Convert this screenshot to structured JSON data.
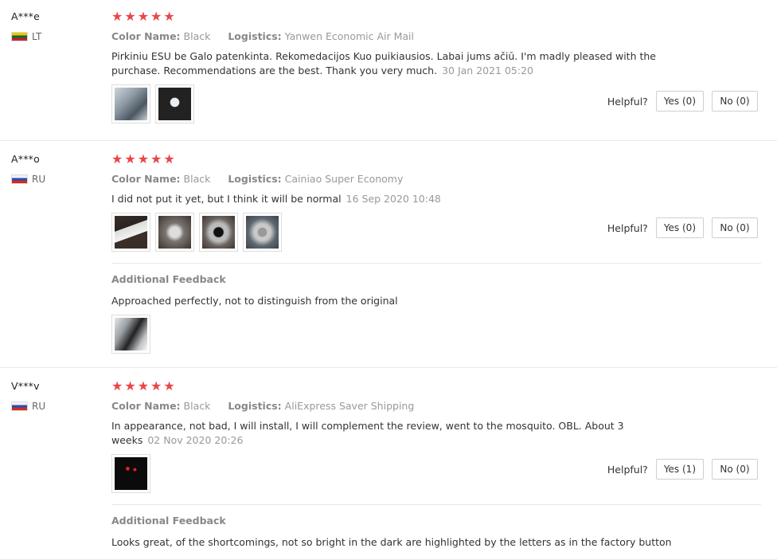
{
  "reviews": [
    {
      "name": "A***e",
      "country": "LT",
      "stars": [
        "★",
        "★",
        "★",
        "★",
        "★"
      ],
      "color_label": "Color Name:",
      "color_value": "Black",
      "logistics_label": "Logistics:",
      "logistics_value": "Yanwen Economic Air Mail",
      "text": "Pirkiniu ESU be Galo patenkinta. Rekomedacijos Kuo puikiausios. Labai jums ačiū. I'm madly pleased with the purchase. Recommendations are the best. Thank you very much.",
      "date": "30 Jan 2021 05:20",
      "helpful_label": "Helpful?",
      "yes_label": "Yes (0)",
      "no_label": "No (0)"
    },
    {
      "name": "A***o",
      "country": "RU",
      "stars": [
        "★",
        "★",
        "★",
        "★",
        "★"
      ],
      "color_label": "Color Name:",
      "color_value": "Black",
      "logistics_label": "Logistics:",
      "logistics_value": "Cainiao Super Economy",
      "text": "I did not put it yet, but I think it will be normal",
      "date": "16 Sep 2020 10:48",
      "helpful_label": "Helpful?",
      "yes_label": "Yes (0)",
      "no_label": "No (0)",
      "additional_title": "Additional Feedback",
      "additional_text": "Approached perfectly, not to distinguish from the original"
    },
    {
      "name": "V***v",
      "country": "RU",
      "stars": [
        "★",
        "★",
        "★",
        "★",
        "★"
      ],
      "color_label": "Color Name:",
      "color_value": "Black",
      "logistics_label": "Logistics:",
      "logistics_value": "AliExpress Saver Shipping",
      "text": "In appearance, not bad, I will install, I will complement the review, went to the mosquito. OBL. About 3 weeks",
      "date": "02 Nov 2020 20:26",
      "helpful_label": "Helpful?",
      "yes_label": "Yes (1)",
      "no_label": "No (0)",
      "additional_title": "Additional Feedback",
      "additional_text": "Looks great, of the shortcomings, not so bright in the dark are highlighted by the letters as in the factory button"
    }
  ],
  "colors": {
    "star": "#e8474a",
    "meta_gray": "#999999",
    "border": "#e8e8e8"
  }
}
